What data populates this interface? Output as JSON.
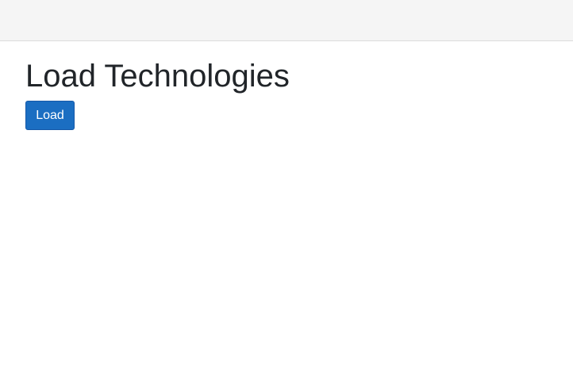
{
  "page": {
    "title": "Load Technologies"
  },
  "actions": {
    "load_label": "Load"
  },
  "colors": {
    "navbar_bg": "#f5f5f5",
    "button_bg": "#1b6ec2",
    "button_border": "#1558a8",
    "text": "#212529"
  }
}
